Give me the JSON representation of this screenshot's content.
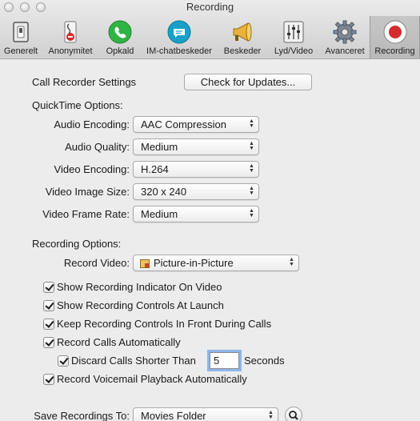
{
  "window": {
    "title": "Recording"
  },
  "toolbar": {
    "items": [
      {
        "label": "Generelt",
        "icon": "switch-icon"
      },
      {
        "label": "Anonymitet",
        "icon": "privacy-icon"
      },
      {
        "label": "Opkald",
        "icon": "phone-icon"
      },
      {
        "label": "IM-chatbeskeder",
        "icon": "chat-icon"
      },
      {
        "label": "Beskeder",
        "icon": "megaphone-icon"
      },
      {
        "label": "Lyd/Video",
        "icon": "sliders-icon"
      },
      {
        "label": "Avanceret",
        "icon": "gear-icon"
      },
      {
        "label": "Recording",
        "icon": "record-icon",
        "selected": true
      }
    ]
  },
  "settings": {
    "section_title": "Call Recorder Settings",
    "check_updates_label": "Check for Updates..."
  },
  "quicktime": {
    "heading": "QuickTime Options:",
    "audio_encoding_label": "Audio Encoding:",
    "audio_encoding_value": "AAC Compression",
    "audio_quality_label": "Audio Quality:",
    "audio_quality_value": "Medium",
    "video_encoding_label": "Video Encoding:",
    "video_encoding_value": "H.264",
    "video_size_label": "Video Image Size:",
    "video_size_value": "320 x 240",
    "frame_rate_label": "Video Frame Rate:",
    "frame_rate_value": "Medium"
  },
  "recording": {
    "heading": "Recording Options:",
    "record_video_label": "Record Video:",
    "record_video_value": "Picture-in-Picture",
    "options": [
      {
        "label": "Show Recording Indicator On Video",
        "checked": true
      },
      {
        "label": "Show Recording Controls At Launch",
        "checked": true
      },
      {
        "label": "Keep Recording Controls In Front During Calls",
        "checked": true
      },
      {
        "label": "Record Calls Automatically",
        "checked": true
      }
    ],
    "discard_label": "Discard Calls Shorter Than",
    "discard_value": "5",
    "discard_unit": "Seconds",
    "voicemail_label": "Record Voicemail Playback Automatically"
  },
  "save": {
    "label": "Save Recordings To:",
    "value": "Movies Folder"
  },
  "colors": {
    "accent_focus": "#8fb5ea",
    "record_red": "#d42c2c",
    "phone_green": "#2fb443",
    "chat_teal": "#19a0c6"
  }
}
